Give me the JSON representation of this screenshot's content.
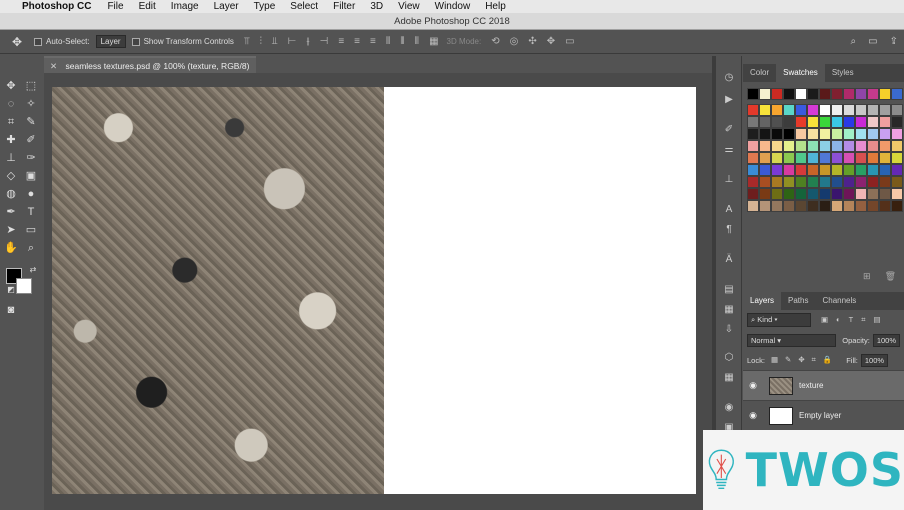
{
  "menubar": {
    "app": "Photoshop CC",
    "items": [
      "File",
      "Edit",
      "Image",
      "Layer",
      "Type",
      "Select",
      "Filter",
      "3D",
      "View",
      "Window",
      "Help"
    ]
  },
  "window": {
    "title": "Adobe Photoshop CC 2018"
  },
  "options": {
    "auto_select_label": "Auto-Select:",
    "auto_select_value": "Layer",
    "show_transform_label": "Show Transform Controls",
    "threed_mode": "3D Mode:"
  },
  "document": {
    "tab_title": "seamless textures.psd @ 100% (texture, RGB/8)"
  },
  "swatches_panel": {
    "tabs": [
      "Color",
      "Swatches",
      "Styles"
    ],
    "active_tab": "Swatches",
    "recent": [
      "#000000",
      "#f5f0d0",
      "#cc2a22",
      "#111111",
      "#ffffff",
      "#1a1a1a",
      "#5a1a1a",
      "#802030",
      "#b02a6a",
      "#8e45a8",
      "#c43a8c",
      "#f5d02a",
      "#3a6ad0"
    ],
    "grid": [
      "#e3392b",
      "#f7e33a",
      "#f7a52f",
      "#5ad6c8",
      "#3a5ae0",
      "#d63ad6",
      "#ffffff",
      "#f0f0f0",
      "#dcdcdc",
      "#c8c8c8",
      "#b4b4b4",
      "#a0a0a0",
      "#8c8c8c",
      "#787878",
      "#646464",
      "#505050",
      "#3c3c3c",
      "#e63a2a",
      "#f7e03a",
      "#3ad63a",
      "#3ac8e6",
      "#2a3ae6",
      "#c82ad6",
      "#f0c8c8",
      "#f0a0a0",
      "#282828",
      "#1e1e1e",
      "#141414",
      "#0a0a0a",
      "#000000",
      "#f7c8a0",
      "#f7e0a0",
      "#f0f0a0",
      "#c8f0a0",
      "#a0f0c8",
      "#a0e0f0",
      "#a0c8f0",
      "#c8a0f0",
      "#f0a0e0",
      "#f0a0a0",
      "#f7b88c",
      "#f7d88c",
      "#e6f08c",
      "#b4e08c",
      "#8ce0b4",
      "#8cd0e6",
      "#8cb4e6",
      "#b48ce6",
      "#e68cd0",
      "#e68c8c",
      "#f09a6a",
      "#f0c86a",
      "#e07850",
      "#e0a050",
      "#d6d650",
      "#8cc850",
      "#50c88c",
      "#50b4d6",
      "#5078d6",
      "#8c50d6",
      "#d650b4",
      "#d65050",
      "#e07a3a",
      "#e0b43a",
      "#d6d63a",
      "#3a8cd6",
      "#3a5ad6",
      "#7a3ad6",
      "#d63aa0",
      "#d63a3a",
      "#c86428",
      "#c89628",
      "#b4b428",
      "#64a028",
      "#28a064",
      "#2896b4",
      "#2864b4",
      "#6428b4",
      "#a82a2a",
      "#a84e22",
      "#a87a22",
      "#909022",
      "#4e8022",
      "#228050",
      "#22788c",
      "#224e8c",
      "#4e228c",
      "#8c2270",
      "#8c2222",
      "#7a3a1a",
      "#7a5a1a",
      "#6e1e1e",
      "#7a3a14",
      "#6e6e14",
      "#2e6414",
      "#14643a",
      "#14586e",
      "#143a6e",
      "#3a146e",
      "#6e1458",
      "#f0b4b4",
      "#8c7058",
      "#6e5846",
      "#f7c8a8",
      "#d6b494",
      "#b49478",
      "#94785e",
      "#7a5e46",
      "#5a4632",
      "#3e2e20",
      "#2a1e14",
      "#d6a878",
      "#b4845a",
      "#946040",
      "#74462a",
      "#54301a",
      "#38200e"
    ]
  },
  "layers_panel": {
    "tabs": [
      "Layers",
      "Paths",
      "Channels"
    ],
    "active_tab": "Layers",
    "filter": "Kind",
    "blend_mode": "Normal",
    "opacity_label": "Opacity:",
    "opacity_value": "100%",
    "lock_label": "Lock:",
    "fill_label": "Fill:",
    "fill_value": "100%",
    "layers": [
      {
        "name": "texture",
        "selected": true
      },
      {
        "name": "Empty layer",
        "selected": false
      }
    ]
  },
  "watermark": {
    "text": "TWOS"
  }
}
